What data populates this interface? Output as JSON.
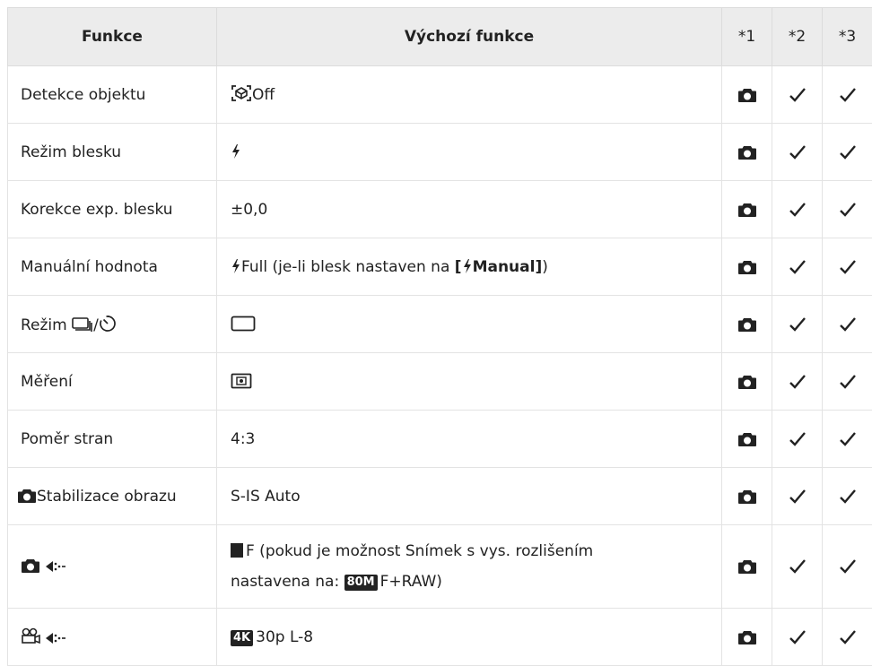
{
  "header": {
    "col_function": "Funkce",
    "col_default": "Výchozí funkce",
    "col1": "*1",
    "col2": "*2",
    "col3": "*3"
  },
  "rows": [
    {
      "function": "Detekce objektu",
      "default": "Off"
    },
    {
      "function": "Režim blesku",
      "default": ""
    },
    {
      "function": "Korekce exp. blesku",
      "default": "±0,0"
    },
    {
      "function": "Manuální hodnota",
      "default_pre": "Full (je-li blesk nastaven na ",
      "default_bold_open": "[",
      "default_bold_text": "Manual]",
      "default_post": ")"
    },
    {
      "function_pre": "Režim ",
      "function_mid": "/",
      "default": ""
    },
    {
      "function": "Měření",
      "default": ""
    },
    {
      "function": "Poměr stran",
      "default": "4:3"
    },
    {
      "function": "Stabilizace obrazu",
      "default": "S-IS Auto"
    },
    {
      "function": "",
      "default_line1": "F (pokud je možnost Snímek s vys. rozlišením",
      "default_line2_pre": "nastavena na: ",
      "default_badge": "80M",
      "default_line2_post": "F+RAW)"
    },
    {
      "function": "",
      "default_badge": "4K",
      "default": "30p L-8"
    }
  ],
  "icons": {
    "col1_mark": "camera-icon",
    "col2_mark": "checkmark-icon",
    "col3_mark": "checkmark-icon"
  }
}
